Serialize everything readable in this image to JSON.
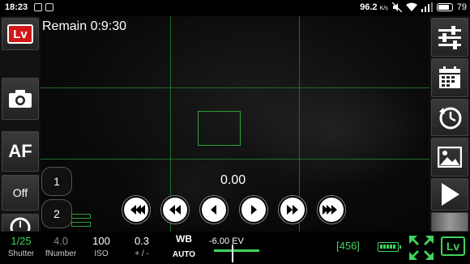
{
  "status_bar": {
    "time": "18:23",
    "network_speed": "96.2",
    "network_unit": "K/s",
    "battery_level": "79",
    "icons": [
      "notification-icon",
      "camera-notify-icon",
      "mute-icon",
      "wifi-icon",
      "signal-icon",
      "battery-icon"
    ]
  },
  "viewfinder": {
    "remaining_label": "Remain 0:9:30",
    "ev_readout": "0.00",
    "grid": "rule-of-thirds",
    "af_box_color": "#2aa03a"
  },
  "left_column": {
    "live_view_label": "Lv",
    "camera_button": "camera-icon",
    "af_label": "AF",
    "off_label": "Off",
    "timer_button": "self-timer-icon"
  },
  "number_buttons": [
    "1",
    "2"
  ],
  "playback": [
    "fast-rewind-icon",
    "rewind-icon",
    "step-back-icon",
    "step-forward-icon",
    "forward-icon",
    "fast-forward-icon"
  ],
  "right_column": {
    "settings": "sliders-icon",
    "calendar": "calendar-icon",
    "history": "history-clock-icon",
    "gallery": "image-icon",
    "play": "play-icon",
    "thumbnail": "thumbnail-preview"
  },
  "bottom_bar": {
    "shutter_value": "1/25",
    "shutter_label": "Shutter",
    "fnumber_value": "4.0",
    "fnumber_label": "fNumber",
    "iso_value": "100",
    "iso_label": "ISO",
    "exposure_value": "0.3",
    "exposure_label": "+ / -",
    "wb_label": "WB",
    "wb_value": "AUTO",
    "ev_scale": "-6.00 EV",
    "shot_count": "[456]",
    "live_view_label": "Lv",
    "accent_color": "#3fd35c"
  }
}
